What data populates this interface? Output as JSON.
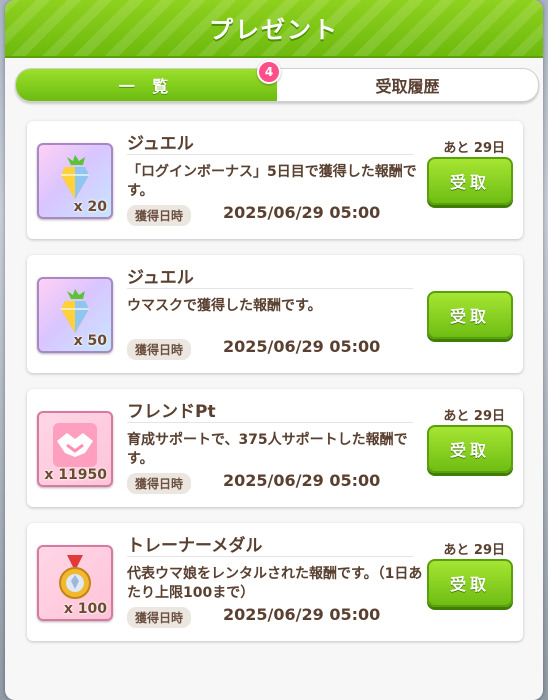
{
  "header": {
    "title": "プレゼント"
  },
  "tabs": [
    {
      "label": "一 覧",
      "active": true
    },
    {
      "label": "受取履歴",
      "active": false
    }
  ],
  "tab_badge": "4",
  "items": [
    {
      "name": "ジュエル",
      "icon": "jewel-icon",
      "quantity": "x 20",
      "description": "「ログインボーナス」5日目で獲得した報酬です。",
      "date_label": "獲得日時",
      "date": "2025/06/29 05:00",
      "remaining": "あと 29日",
      "button": "受取"
    },
    {
      "name": "ジュエル",
      "icon": "jewel-icon",
      "quantity": "x 50",
      "description": "ウマスクで獲得した報酬です。",
      "date_label": "獲得日時",
      "date": "2025/06/29 05:00",
      "remaining": "",
      "button": "受取"
    },
    {
      "name": "フレンドPt",
      "icon": "handshake-icon",
      "quantity": "x 11950",
      "description": "育成サポートで、375人サポートした報酬です。",
      "date_label": "獲得日時",
      "date": "2025/06/29 05:00",
      "remaining": "あと 29日",
      "button": "受取"
    },
    {
      "name": "トレーナーメダル",
      "icon": "medal-icon",
      "quantity": "x 100",
      "description": "代表ウマ娘をレンタルされた報酬です。（1日あたり上限100まで）",
      "date_label": "獲得日時",
      "date": "2025/06/29 05:00",
      "remaining": "あと 29日",
      "button": "受取"
    }
  ],
  "colors": {
    "accent_green": "#6fbd13",
    "text_brown": "#5a4030",
    "badge_pink": "#ff4f8b"
  }
}
